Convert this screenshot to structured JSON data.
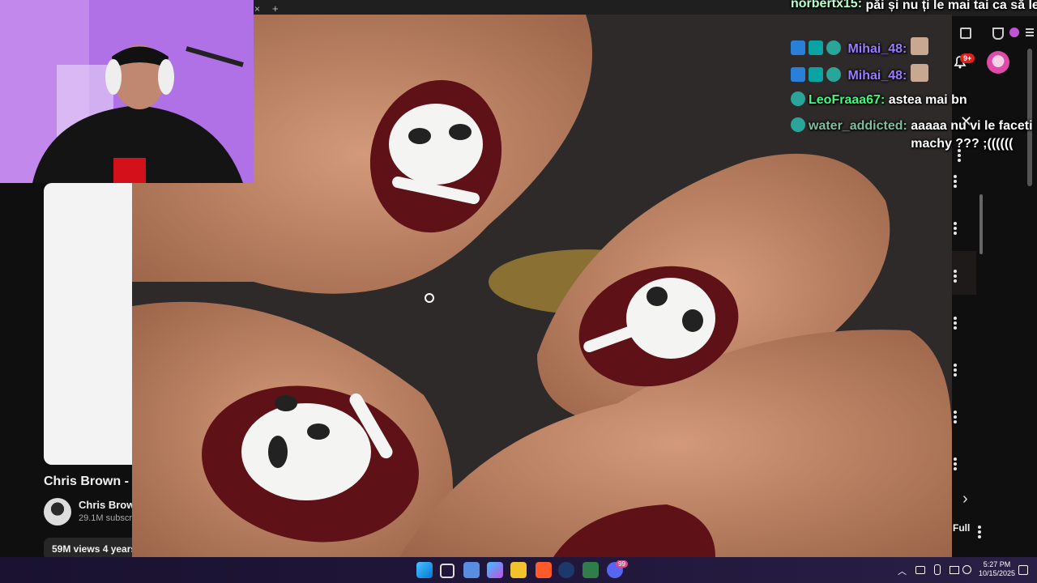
{
  "browser": {
    "tab_close": "×",
    "tab_new": "+"
  },
  "youtube": {
    "video_title": "Chris Brown - I",
    "channel_name": "Chris Brow",
    "subscribers": "29.1M subscri",
    "views": "59M views  4 years",
    "full_label": "Full"
  },
  "chat": [
    {
      "user": "norbertx15",
      "text": "păi și nu ți le mai tai ca să le faci",
      "user_color": "#b8ffd0",
      "text_color": "#ffffff"
    },
    {
      "user": "Mihai_48",
      "text": "",
      "user_color": "#9b7bff",
      "text_color": "#ffffff"
    },
    {
      "user": "Mihai_48",
      "text": "",
      "user_color": "#9b7bff",
      "text_color": "#ffffff"
    },
    {
      "user": "LeoFraaa67",
      "text": "astea mai bn",
      "user_color": "#39ff7a",
      "text_color": "#ffffff"
    },
    {
      "user": "water_addicted",
      "text": "aaaaa nu vi le faceti machy ??? ;((((((",
      "user_color": "#7fbfa0",
      "text_color": "#ffffff"
    }
  ],
  "notifications": {
    "count": "9+"
  },
  "taskbar": {
    "discord_badge": "99",
    "time": "5:27 PM",
    "date": "10/15/2025"
  },
  "colors": {
    "nail_polish": "#5e1218",
    "skin": "#c98f6e",
    "skull": "#f4f4f2",
    "webcam_bg": "#b070e6"
  }
}
